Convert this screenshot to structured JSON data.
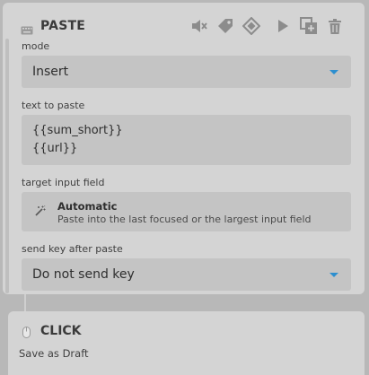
{
  "paste_step": {
    "title": "PASTE",
    "mode": {
      "label": "mode",
      "value": "Insert"
    },
    "text_to_paste": {
      "label": "text to paste",
      "lines": [
        "{{sum_short}}",
        "{{url}}"
      ]
    },
    "target_input": {
      "label": "target input field",
      "title": "Automatic",
      "description": "Paste into the last focused or the largest input field"
    },
    "send_key": {
      "label": "send key after paste",
      "value": "Do not send key"
    },
    "toolbar_icons": [
      "mute-icon",
      "tag-icon",
      "diamond-icon",
      "play-icon",
      "duplicate-icon",
      "trash-icon"
    ]
  },
  "click_step": {
    "title": "CLICK",
    "subtitle": "Save as Draft"
  },
  "colors": {
    "accent": "#2d8fcf",
    "card": "#d4d4d4",
    "field": "#c4c4c4",
    "background": "#b8b8b8"
  }
}
